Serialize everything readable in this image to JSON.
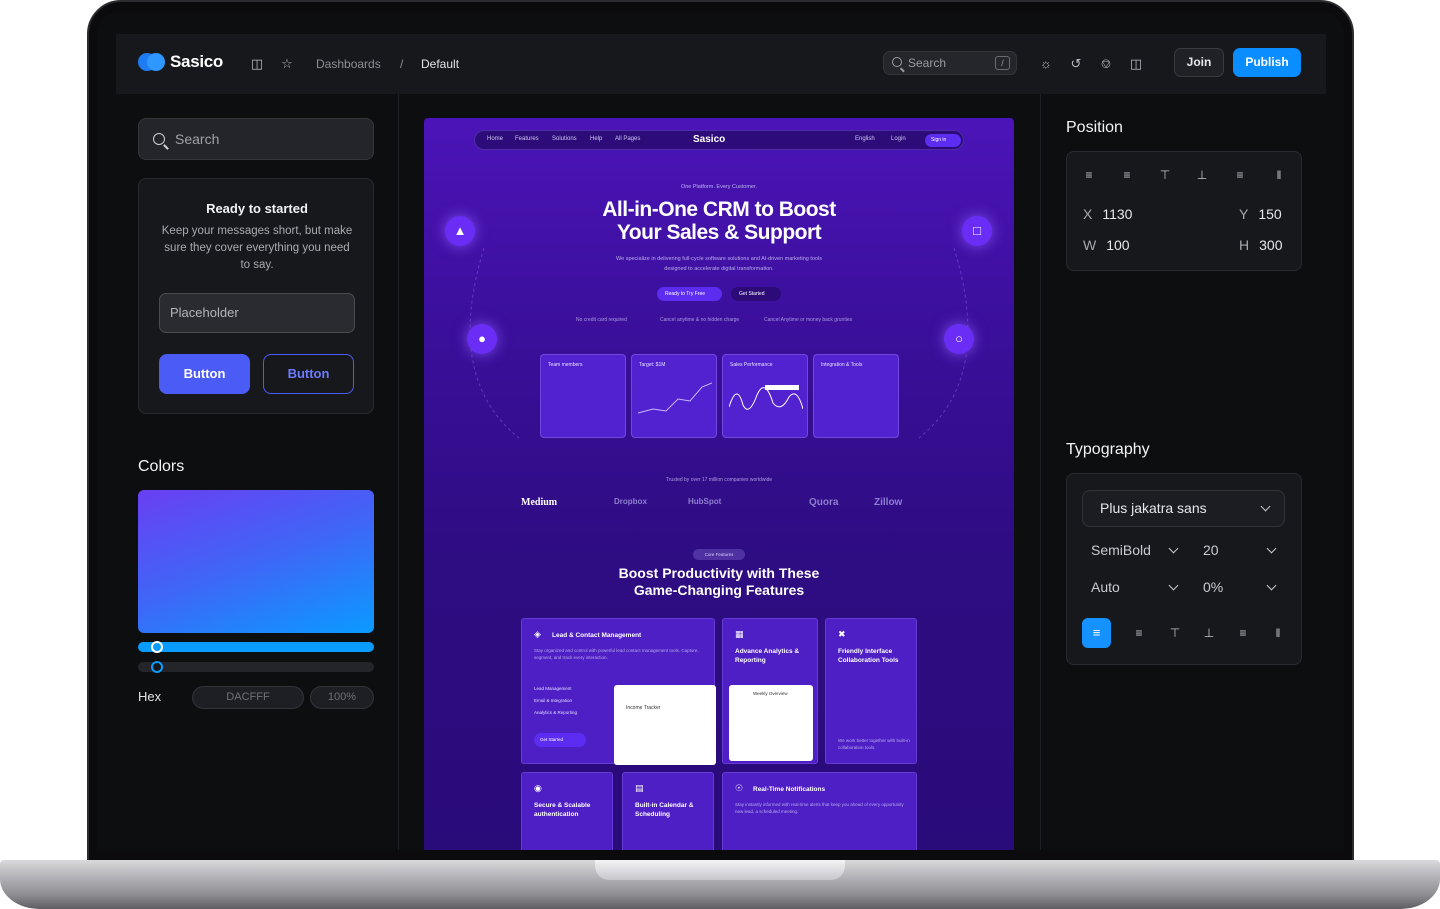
{
  "app": {
    "brand": "Sasico",
    "breadcrumb": [
      "Dashboards",
      "/",
      "Default"
    ],
    "search_placeholder": "Search",
    "search_shortcut": "/",
    "join_label": "Join",
    "publish_label": "Publish",
    "accent": "#0a8dff"
  },
  "left_panel": {
    "search_placeholder": "Search",
    "card": {
      "title": "Ready to started",
      "description": "Keep your messages short, but make sure they cover everything you need to say.",
      "input_placeholder": "Placeholder",
      "primary_button": "Button",
      "outline_button": "Button"
    },
    "colors": {
      "title": "Colors",
      "hue_position": 0.06,
      "alpha_position": 0.06,
      "hex_label": "Hex",
      "hex_value": "DACFFF",
      "opacity": "100%"
    }
  },
  "preview": {
    "nav": {
      "items": [
        "Home",
        "Features",
        "Solutions",
        "Help",
        "All Pages"
      ],
      "brand": "Sasico",
      "right_items": [
        "English",
        "Login"
      ],
      "sign_in": "Sign in"
    },
    "eyebrow": "One Platform. Every Customer.",
    "headline_line1": "All-in-One CRM to Boost",
    "headline_line2": "Your Sales & Support",
    "subtext": "We specialize in delivering full-cycle software solutions and AI-driven marketing tools designed to accelerate digital transformation.",
    "cta_primary": "Ready to Try Free",
    "cta_secondary": "Get Started",
    "checks": [
      "No credit card required",
      "Cancel anytime & no hidden charge",
      "Cancel Anytime or money back grunties"
    ],
    "mini_cards": [
      "Team members",
      "Target: $1M",
      "Sales Performance",
      "Integration & Tools"
    ],
    "trusted": "Trusted by over 17 million companies worldwide",
    "brands": [
      "Medium",
      "Dropbox",
      "HubSpot",
      "Quora",
      "Zillow"
    ],
    "pill": "Core Features",
    "section_title_line1": "Boost Productivity with These",
    "section_title_line2": "Game-Changing Features",
    "features": {
      "f1_title": "Lead & Contact Management",
      "f1_desc": "Stay organized and control with powerful lead contact management tools. Capture, segment, and track every interaction.",
      "f1_list": [
        "Lead Management",
        "Email & Integration",
        "Analytics & Reporting"
      ],
      "f1_cta": "Get Started",
      "f1_shot": "Income Tracker",
      "f2_title": "Advance Analytics & Reporting",
      "f2_shot": "Weekly Overview",
      "f3_title": "Friendly Interface Collaboration Tools",
      "f3_desc": "We work better together with built-in collaboration tools.",
      "f4_title": "Secure & Scalable authentication",
      "f5_title": "Built-in Calendar & Scheduling",
      "f6_title": "Real-Time Notifications",
      "f6_desc": "Stay instantly informed with real-time alerts that keep you ahead of every opportunity new lead, a scheduled meeting."
    }
  },
  "right_panel": {
    "position_title": "Position",
    "x_label": "X",
    "x_value": "1130",
    "y_label": "Y",
    "y_value": "150",
    "w_label": "W",
    "w_value": "100",
    "h_label": "H",
    "h_value": "300",
    "typography_title": "Typography",
    "font_family": "Plus jakatra sans",
    "font_weight": "SemiBold",
    "font_size": "20",
    "line_height": "Auto",
    "letter_spacing": "0%"
  }
}
